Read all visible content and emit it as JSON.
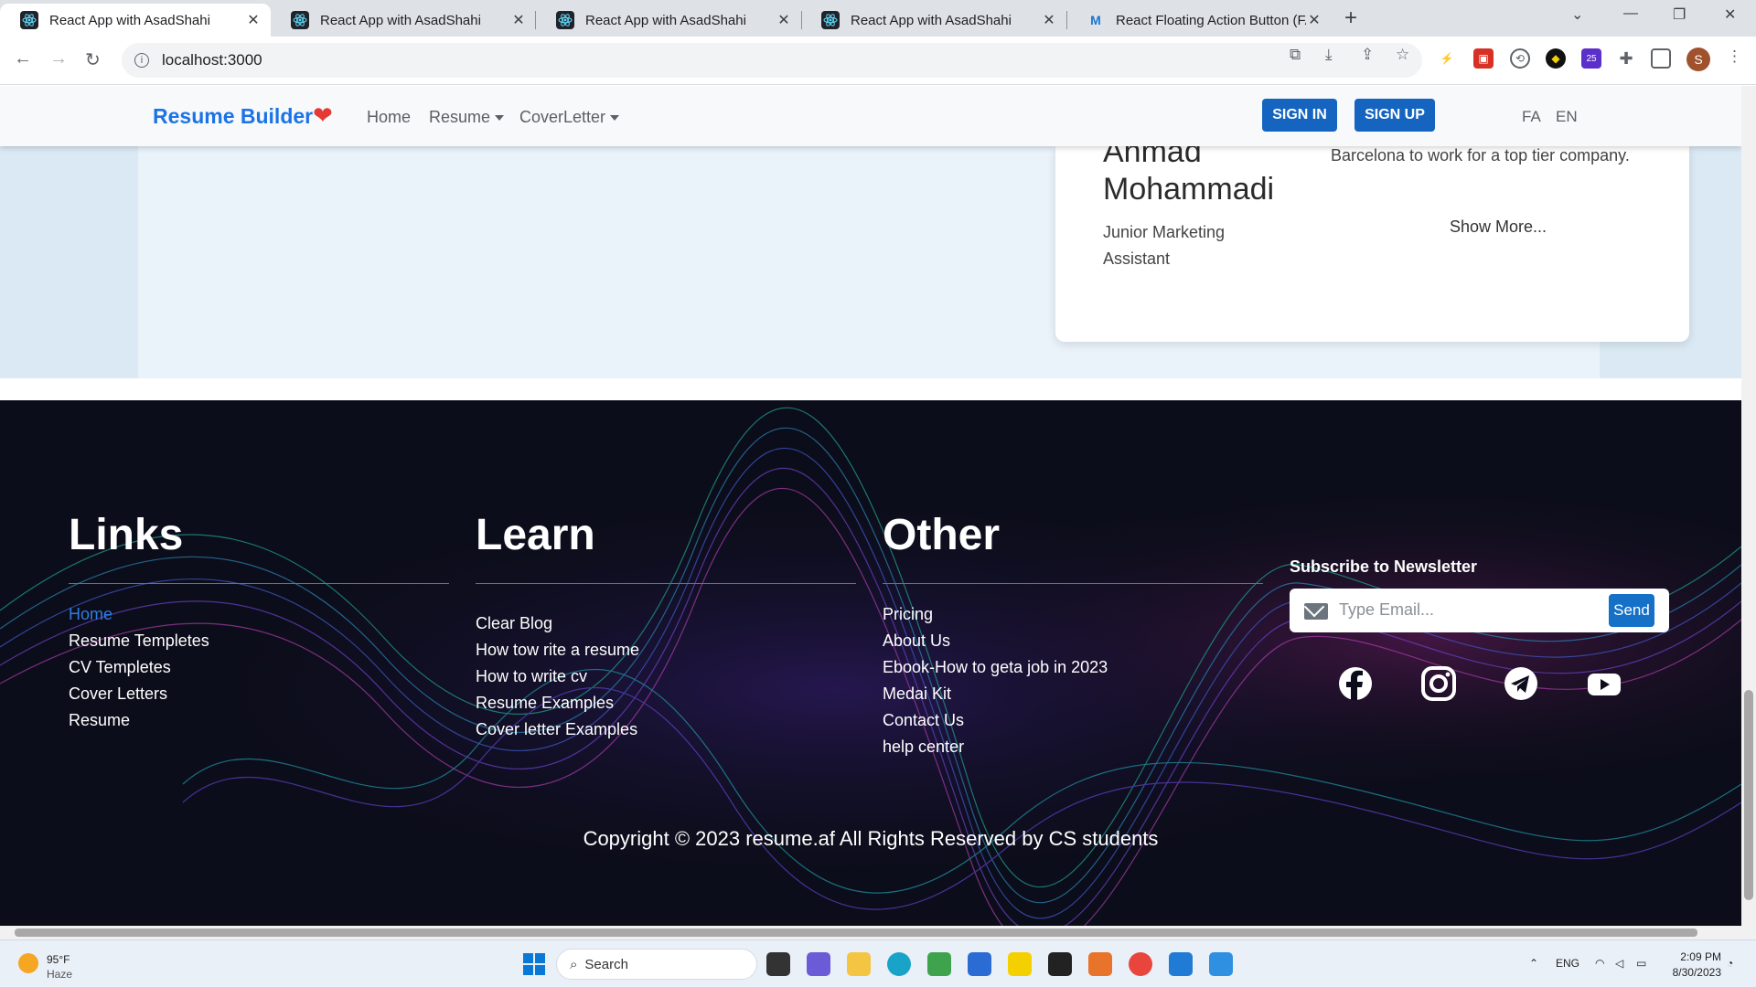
{
  "browser": {
    "tabs": [
      {
        "title": "React App with AsadShahi",
        "active": true
      },
      {
        "title": "React App with AsadShahi",
        "active": false
      },
      {
        "title": "React App with AsadShahi",
        "active": false
      },
      {
        "title": "React App with AsadShahi",
        "active": false
      },
      {
        "title": "React Floating Action Button (FAB",
        "active": false
      }
    ],
    "url": "localhost:3000",
    "profile_initial": "S",
    "extension_badge": "25"
  },
  "navbar": {
    "brand": "Resume Builder",
    "links": [
      "Home",
      "Resume",
      "CoverLetter"
    ],
    "sign_in": "SIGN IN",
    "sign_up": "SIGN UP",
    "languages": [
      "FA",
      "EN"
    ]
  },
  "card": {
    "name": "Ahmad Mohammadi",
    "role": "Junior Marketing Assistant",
    "description": "Barcelona to work for a top tier company.",
    "show_more": "Show More..."
  },
  "footer": {
    "columns": [
      {
        "title": "Links",
        "items": [
          "Home",
          "Resume Templetes",
          "CV Templetes",
          "Cover Letters",
          "Resume"
        ]
      },
      {
        "title": "Learn",
        "items": [
          "Clear Blog",
          "How tow rite a resume",
          "How to write cv",
          "Resume Examples",
          "Cover letter Examples"
        ]
      },
      {
        "title": "Other",
        "items": [
          "Pricing",
          "About Us",
          "Ebook-How to geta job in 2023",
          "Medai Kit",
          "Contact Us",
          "help center"
        ]
      }
    ],
    "newsletter": {
      "title": "Subscribe to Newsletter",
      "placeholder": "Type Email...",
      "button": "Send"
    },
    "social": [
      "facebook-icon",
      "instagram-icon",
      "telegram-icon",
      "youtube-icon"
    ],
    "copyright": "Copyright © 2023 resume.af All Rights Reserved by CS students"
  },
  "taskbar": {
    "weather_temp": "95°F",
    "weather_desc": "Haze",
    "search": "Search",
    "language": "ENG",
    "time": "2:09 PM",
    "date": "8/30/2023"
  },
  "colors": {
    "brand": "#1a73e8",
    "primary_button": "#1565c0",
    "footer_bg": "#0c0d1a",
    "heart": "#e53935"
  }
}
